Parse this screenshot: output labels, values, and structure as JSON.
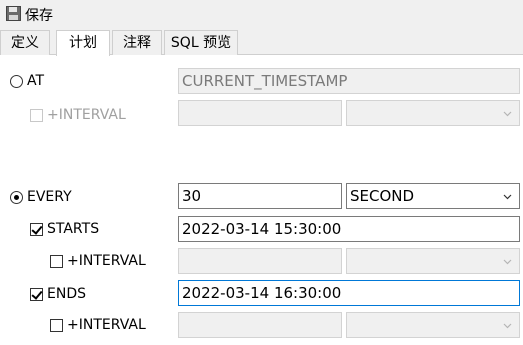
{
  "toolbar": {
    "save_label": "保存"
  },
  "tabs": [
    {
      "label": "定义"
    },
    {
      "label": "计划"
    },
    {
      "label": "注释"
    },
    {
      "label": "SQL 预览"
    }
  ],
  "at": {
    "label": "AT",
    "value": "CURRENT_TIMESTAMP",
    "interval_label": "+INTERVAL",
    "interval_value": "",
    "interval_unit": ""
  },
  "every": {
    "label": "EVERY",
    "value": "30",
    "unit": "SECOND"
  },
  "starts": {
    "label": "STARTS",
    "value": "2022-03-14 15:30:00",
    "interval_label": "+INTERVAL",
    "interval_value": "",
    "interval_unit": ""
  },
  "ends": {
    "label": "ENDS",
    "value": "2022-03-14 16:30:00",
    "interval_label": "+INTERVAL",
    "interval_value": "",
    "interval_unit": ""
  }
}
